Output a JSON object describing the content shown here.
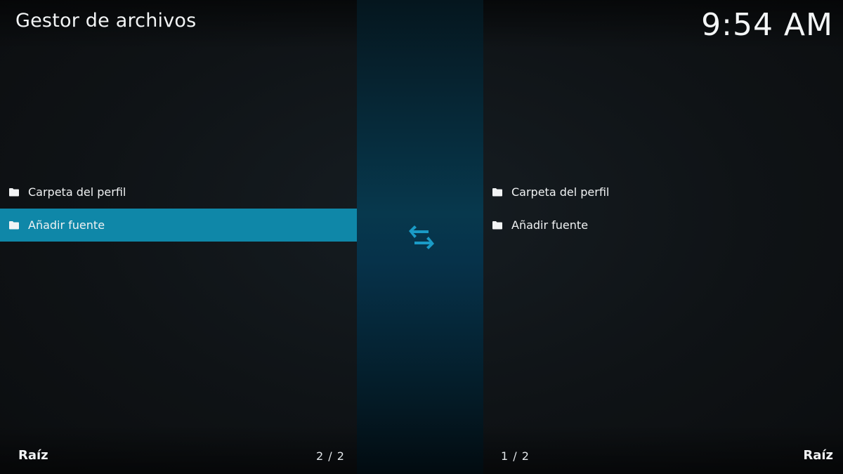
{
  "app": {
    "title": "Gestor de archivos",
    "clock": "9:54 AM"
  },
  "left_pane": {
    "items": [
      {
        "label": "Carpeta del perfil",
        "icon": "folder-icon",
        "selected": false
      },
      {
        "label": "Añadir fuente",
        "icon": "folder-icon",
        "selected": true
      }
    ],
    "path": "Raíz",
    "count": "2 / 2"
  },
  "right_pane": {
    "items": [
      {
        "label": "Carpeta del perfil",
        "icon": "folder-icon",
        "selected": false
      },
      {
        "label": "Añadir fuente",
        "icon": "folder-icon",
        "selected": false
      }
    ],
    "path": "Raíz",
    "count": "1 / 2"
  },
  "center": {
    "icon": "swap-arrows-icon"
  },
  "colors": {
    "accent": "#0f87a8",
    "divider": "#07384d",
    "background": "#0f1316",
    "swap_icon": "#1a9bc6"
  }
}
